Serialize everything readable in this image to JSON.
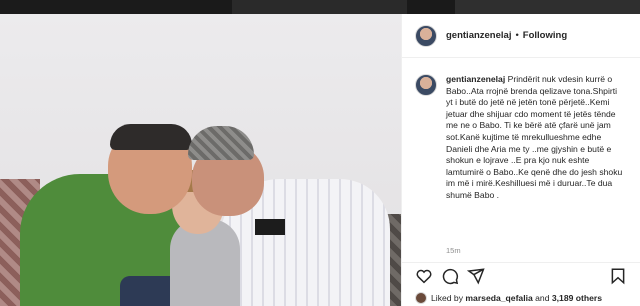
{
  "post": {
    "username": "gentianzenelaj",
    "separator": "•",
    "follow_status": "Following",
    "caption": "Prindërit nuk vdesin kurrë o Babo..Ata rrojnë brenda qelizave tona.Shpirti yt i butë do jetë në jetën tonë përjetë..Kemi jetuar dhe shijuar cdo moment të jetës tënde me ne o Babo. Ti ke bërë atë çfarë unë jam sot.Kanë kujtime të mrekullueshme edhe Danieli dhe Aria me ty ..me gjyshin e butë e shokun e lojrave ..E pra kjo nuk eshte lamtumirë o Babo..Ke qenë dhe do jesh shoku im më i mirë.Keshilluesi më i duruar..Te dua shumë Babo .",
    "time_ago": "15m"
  },
  "likes": {
    "prefix": "Liked by",
    "liker": "marseda_qefalia",
    "middle": "and",
    "others": "3,189 others"
  },
  "icons": {
    "like": "heart-icon",
    "comment": "comment-icon",
    "share": "paper-plane-icon",
    "save": "bookmark-icon"
  },
  "colors": {
    "text": "#262626",
    "muted": "#8e8e8e",
    "border": "#efefef",
    "overlay": "#6e6e6e"
  }
}
